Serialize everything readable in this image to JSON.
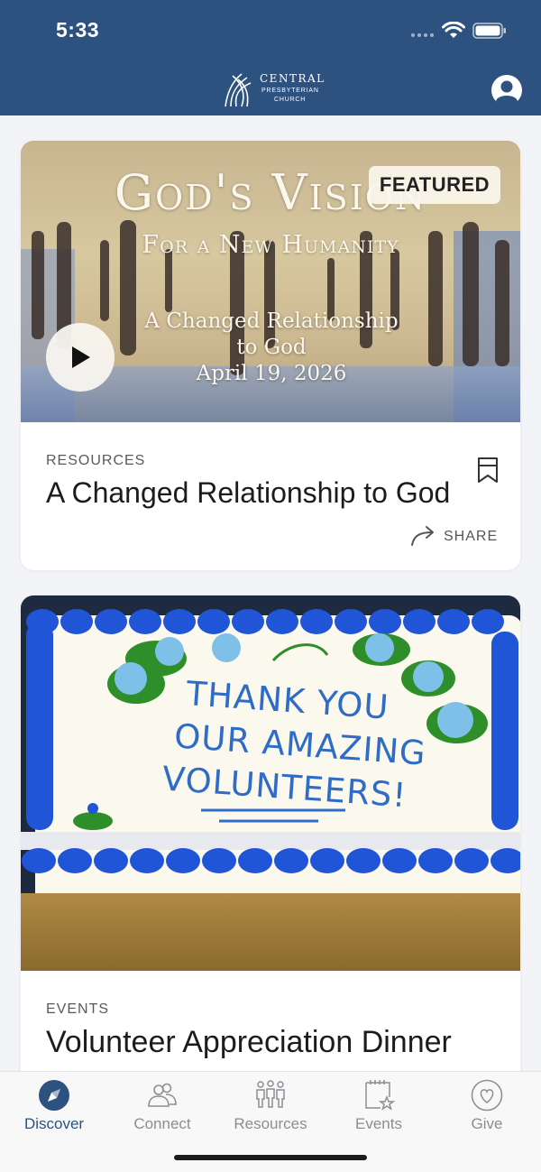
{
  "status_bar": {
    "time": "5:33"
  },
  "header": {
    "logo_line1": "CENTRAL",
    "logo_line2": "PRESBYTERIAN",
    "logo_line3": "CHURCH"
  },
  "cards": [
    {
      "badge": "FEATURED",
      "hero_title": "God's Vision",
      "hero_subtitle": "For a New Humanity",
      "hero_caption_line1": "A Changed Relationship",
      "hero_caption_line2": "to God",
      "hero_caption_line3": "April 19, 2026",
      "category": "RESOURCES",
      "title": "A Changed Relationship to God",
      "share_label": "SHARE"
    },
    {
      "cake_line1": "THANK YOU",
      "cake_line2": "OUR AMAZING",
      "cake_line3": "VOLUNTEERS!",
      "category": "EVENTS",
      "title": "Volunteer Appreciation Dinner"
    }
  ],
  "tabs": [
    {
      "label": "Discover",
      "icon": "compass-icon",
      "active": true
    },
    {
      "label": "Connect",
      "icon": "people-icon",
      "active": false
    },
    {
      "label": "Resources",
      "icon": "group-icon",
      "active": false
    },
    {
      "label": "Events",
      "icon": "calendar-star-icon",
      "active": false
    },
    {
      "label": "Give",
      "icon": "heart-icon",
      "active": false
    }
  ],
  "colors": {
    "brand": "#2d5280",
    "background": "#f3f4f7",
    "tab_inactive": "#8d8d92"
  }
}
